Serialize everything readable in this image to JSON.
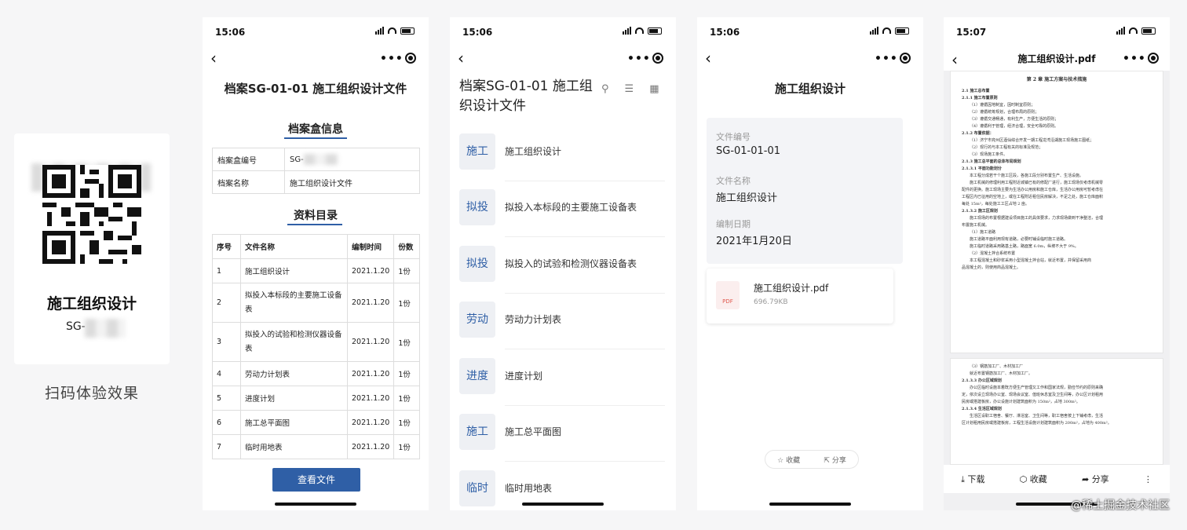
{
  "qr": {
    "title": "施工组织设计",
    "code": "SG-",
    "caption": "扫码体验效果"
  },
  "status": {
    "p1": "15:06",
    "p2": "15:06",
    "p3": "15:06",
    "p4": "15:07"
  },
  "phone1": {
    "title": "档案SG-01-01 施工组织设计文件",
    "box_section": "档案盒信息",
    "box_no_label": "档案盒编号",
    "box_no_value": "SG-",
    "box_name_label": "档案名称",
    "box_name_value": "施工组织设计文件",
    "catalog_section": "资料目录",
    "headers": [
      "序号",
      "文件名称",
      "编制时间",
      "份数"
    ],
    "rows": [
      [
        "1",
        "施工组织设计",
        "2021.1.20",
        "1份"
      ],
      [
        "2",
        "拟投入本标段的主要施工设备表",
        "2021.1.20",
        "1份"
      ],
      [
        "3",
        "拟投入的试验和检测仪器设备表",
        "2021.1.20",
        "1份"
      ],
      [
        "4",
        "劳动力计划表",
        "2021.1.20",
        "1份"
      ],
      [
        "5",
        "进度计划",
        "2021.1.20",
        "1份"
      ],
      [
        "6",
        "施工总平面图",
        "2021.1.20",
        "1份"
      ],
      [
        "7",
        "临时用地表",
        "2021.1.20",
        "1份"
      ]
    ],
    "view_button": "查看文件"
  },
  "phone2": {
    "title": "档案SG-01-01 施工组织设计文件",
    "items": [
      {
        "tag": "施工",
        "text": "施工组织设计"
      },
      {
        "tag": "拟投",
        "text": "拟投入本标段的主要施工设备表"
      },
      {
        "tag": "拟投",
        "text": "拟投入的试验和检测仪器设备表"
      },
      {
        "tag": "劳动",
        "text": "劳动力计划表"
      },
      {
        "tag": "进度",
        "text": "进度计划"
      },
      {
        "tag": "施工",
        "text": "施工总平面图"
      },
      {
        "tag": "临时",
        "text": "临时用地表"
      }
    ]
  },
  "phone3": {
    "title": "施工组织设计",
    "file_no_label": "文件编号",
    "file_no": "SG-01-01-01",
    "file_name_label": "文件名称",
    "file_name": "施工组织设计",
    "date_label": "编制日期",
    "date": "2021年1月20日",
    "pdf_name": "施工组织设计.pdf",
    "pdf_size": "696.79KB",
    "pdf_badge": "PDF",
    "collect": "收藏",
    "share": "分享"
  },
  "phone4": {
    "title": "施工组织设计.pdf",
    "page1": [
      {
        "t": "第 2 章  施工方案与技术措施",
        "c": "dh"
      },
      {
        "t": "2.1 施工总布置",
        "c": "b"
      },
      {
        "t": "2.1.1 施工布置原则",
        "c": "b"
      },
      {
        "t": "（1）遵循因地制宜，因时制宜原则；",
        "c": "i"
      },
      {
        "t": "（2）遵循统筹规划，合理布局的原则；",
        "c": "i"
      },
      {
        "t": "（3）遵循交通畅通，有利生产，方便生活的原则；",
        "c": "i"
      },
      {
        "t": "（4）遵循利于管理，经济合理，安全可靠的原则。",
        "c": "i"
      },
      {
        "t": "2.1.2 布置依据：",
        "c": "b"
      },
      {
        "t": "（1）济宁市兖州区酒仙综合开发一期工程龙湾沿湖施工现场施工图纸；",
        "c": "i"
      },
      {
        "t": "（2）现行的与本工程有关的标准及规范；",
        "c": "i"
      },
      {
        "t": "（3）现场施工条件。",
        "c": "i"
      },
      {
        "t": "2.1.3 施工总平面的总体布局规划",
        "c": "b"
      },
      {
        "t": "2.1.3.1 平面功能划分",
        "c": "b"
      },
      {
        "t": "本工程分成若干个施工区段，各施工段分别布置生产、生活设施。",
        "c": "i"
      },
      {
        "t": "施工机械的修理利用工程附近城镇已有的修配厂进行，施工现场仅考虑机械零",
        "c": "i"
      },
      {
        "t": "配件的更换。施工现场主要为生活办公用房和施工仓库，生活办公用房可暂考虑在",
        "c": ""
      },
      {
        "t": "工程区内已征用的空地上，或在工程附近租住民房解决，不足之处，施工仓库面积",
        "c": ""
      },
      {
        "t": "每处 15m²，每处施工工区占地 2 亩。",
        "c": ""
      },
      {
        "t": "2.1.3.2 施工区规划",
        "c": "b"
      },
      {
        "t": "施工现场的布置根据建设项目施工的具体要求，力求现场做到干净整洁，合理",
        "c": "i"
      },
      {
        "t": "布置施工机械。",
        "c": ""
      },
      {
        "t": "（1）施工道路",
        "c": "i"
      },
      {
        "t": "施工道路平面利用现有道路，必要时铺设临时施工道路。",
        "c": "i"
      },
      {
        "t": "施工临时道路采用路基土路，路面宽 6.0m，纵坡不大于 9%。",
        "c": "i"
      },
      {
        "t": "（2）混凝土拌合系统布置",
        "c": "i"
      },
      {
        "t": "本工程混凝土和砂浆采用小型混凝土拌合站，就近布置，并保留采用商",
        "c": "i"
      },
      {
        "t": "品混凝土的，则使用商品混凝土。",
        "c": ""
      }
    ],
    "page2": [
      {
        "t": "（3）钢筋加工厂、木材加工厂",
        "c": "i"
      },
      {
        "t": "就近布置钢筋加工厂、木材加工厂。",
        "c": "i"
      },
      {
        "t": "2.1.3.3 办公区域规划",
        "c": "b"
      },
      {
        "t": "办公区临时设施本着既方便生产管理又工作和国家法规，勤俭节约的原则来确",
        "c": "i"
      },
      {
        "t": "定，依次设立现场办公室、现场会议室、值班休息室及卫生间等，办公区计划租用",
        "c": ""
      },
      {
        "t": "民房或搭建板房，办公设施计划建筑面积为 150m²，占地 300m²。",
        "c": ""
      },
      {
        "t": "2.1.3.4 生活区域规划",
        "c": "b"
      },
      {
        "t": "生活区设职工宿舍、餐厅、淋浴室、卫生间等，职工宿舍按上下铺考虑，生活",
        "c": "i"
      },
      {
        "t": "区计划租用民房或搭建板房，工程生活设施计划建筑面积为 200m²，占地为 400m²。",
        "c": ""
      }
    ],
    "download": "下载",
    "collect": "收藏",
    "share": "分享"
  },
  "watermark": "@稀土掘金技术社区"
}
